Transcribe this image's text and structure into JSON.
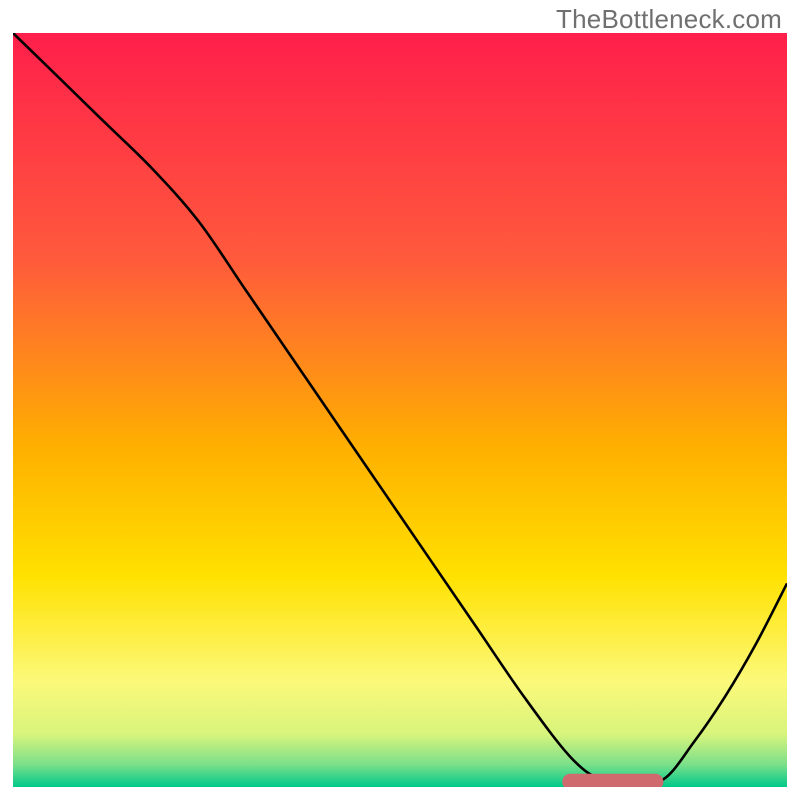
{
  "watermark": "TheBottleneck.com",
  "chart_data": {
    "type": "line",
    "title": "",
    "xlabel": "",
    "ylabel": "",
    "xlim": [
      0,
      100
    ],
    "ylim": [
      0,
      100
    ],
    "gradient_stops": [
      {
        "offset": 0,
        "color": "#ff1f4b"
      },
      {
        "offset": 30,
        "color": "#ff5a3c"
      },
      {
        "offset": 55,
        "color": "#ffb000"
      },
      {
        "offset": 72,
        "color": "#ffe100"
      },
      {
        "offset": 86,
        "color": "#fcf97a"
      },
      {
        "offset": 93,
        "color": "#d8f47c"
      },
      {
        "offset": 97,
        "color": "#7be08a"
      },
      {
        "offset": 100,
        "color": "#00c98a"
      }
    ],
    "curve": {
      "x": [
        0,
        6,
        12,
        18,
        24,
        30,
        36,
        42,
        48,
        54,
        60,
        66,
        72,
        76,
        80,
        84,
        88,
        92,
        96,
        100
      ],
      "y": [
        100,
        94,
        88,
        82,
        75,
        66,
        57,
        48,
        39,
        30,
        21,
        12,
        4,
        1,
        1,
        1,
        6,
        12,
        19,
        27
      ]
    },
    "marker": {
      "x_start": 72,
      "x_end": 83,
      "y": 0.7,
      "color": "#cf6a6f",
      "thickness": 2.4
    }
  }
}
